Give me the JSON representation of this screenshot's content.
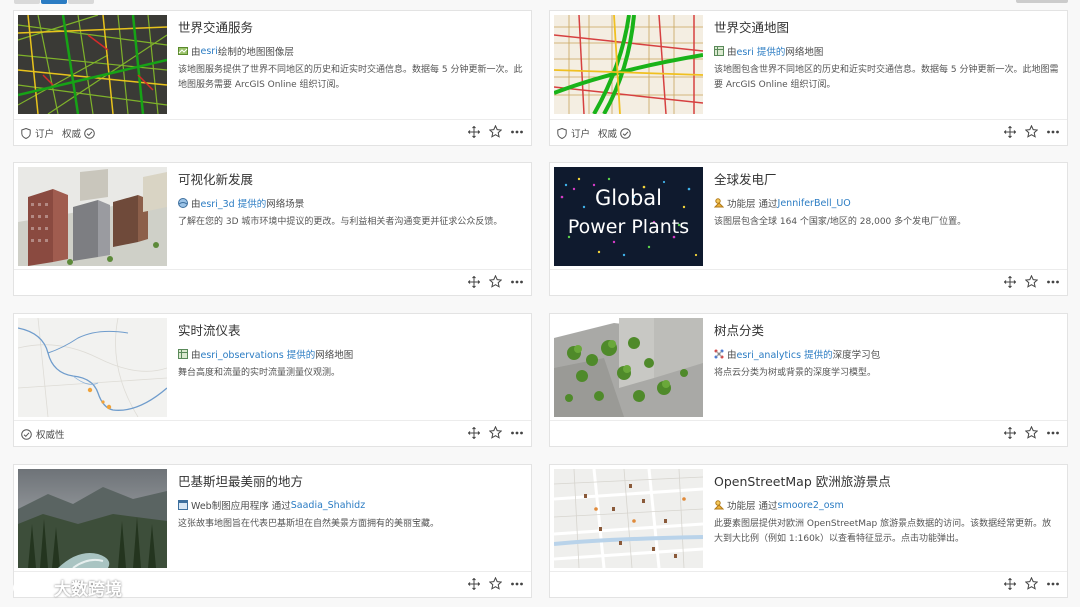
{
  "colors": {
    "accent": "#2b7cc3",
    "text": "#4c4c4c",
    "border": "#e3e3e3"
  },
  "cards": [
    {
      "title": "世界交通服务",
      "type_icon": "map-image-layer-icon",
      "meta_pre": "由",
      "meta_owner": "esri",
      "meta_post": "绘制的地图图像层",
      "desc": "该地图服务提供了世界不同地区的历史和近实时交通信息。数据每 5 分钟更新一次。此地图服务需要 ArcGIS Online 组织订阅。",
      "tags": [
        "订户",
        "权威"
      ]
    },
    {
      "title": "世界交通地图",
      "type_icon": "web-map-icon",
      "meta_pre": "由",
      "meta_owner": "esri 提供的",
      "meta_post": "网络地图",
      "desc": "该地图包含世界不同地区的历史和近实时交通信息。数据每 5 分钟更新一次。此地图需要 ArcGIS Online 组织订阅。",
      "tags": [
        "订户",
        "权威"
      ]
    },
    {
      "title": "可视化新发展",
      "type_icon": "web-scene-icon",
      "meta_pre": "由",
      "meta_owner": "esri_3d 提供的",
      "meta_post": "网络场景",
      "desc": "了解在您的 3D 城市环境中提议的更改。与利益相关者沟通变更并征求公众反馈。",
      "tags": []
    },
    {
      "title": "全球发电厂",
      "type_icon": "feature-layer-icon",
      "meta_pre": "功能层 通过",
      "meta_owner": "JenniferBell_UO",
      "meta_post": "",
      "desc": "该图层包含全球 164 个国家/地区的 28,000 多个发电厂位置。",
      "tags": [],
      "thumb_text": [
        "Global",
        "Power Plants"
      ]
    },
    {
      "title": "实时流仪表",
      "type_icon": "web-map-icon",
      "meta_pre": "由",
      "meta_owner": "esri_observations 提供的",
      "meta_post": "网络地图",
      "desc": "舞台高度和流量的实时流量测量仪观测。",
      "tags": [
        "权威性"
      ]
    },
    {
      "title": "树点分类",
      "type_icon": "deep-learning-package-icon",
      "meta_pre": "由",
      "meta_owner": "esri_analytics 提供的",
      "meta_post": "深度学习包",
      "desc": "将点云分类为树或背景的深度学习模型。",
      "tags": []
    },
    {
      "title": "巴基斯坦最美丽的地方",
      "type_icon": "web-app-icon",
      "meta_pre": "Web制图应用程序 通过",
      "meta_owner": "Saadia_Shahidz",
      "meta_post": "",
      "desc": "这张故事地图旨在代表巴基斯坦在自然美景方面拥有的美丽宝藏。",
      "tags": []
    },
    {
      "title": "OpenStreetMap 欧洲旅游景点",
      "type_icon": "feature-layer-icon",
      "meta_pre": "功能层 通过",
      "meta_owner": "smoore2_osm",
      "meta_post": "",
      "desc": "此要素图层提供对欧洲 OpenStreetMap 旅游景点数据的访问。该数据经常更新。放大到大比例（例如 1:160k）以查看特征显示。点击功能弹出。",
      "tags": []
    }
  ],
  "watermark": {
    "text": "大数跨境"
  }
}
